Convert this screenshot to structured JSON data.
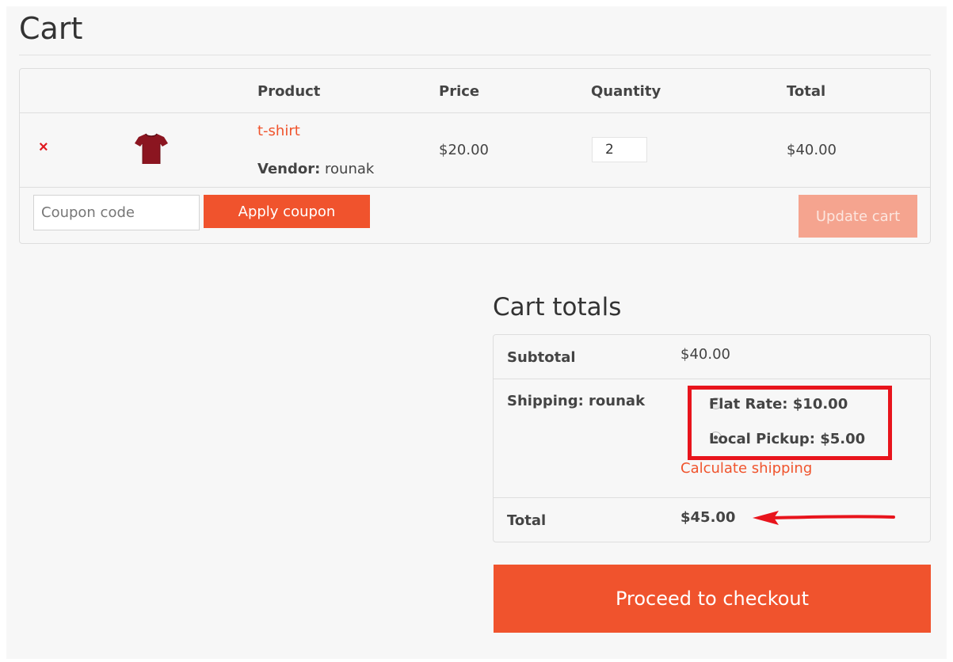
{
  "page": {
    "title": "Cart"
  },
  "cart_table": {
    "headers": {
      "product": "Product",
      "price": "Price",
      "quantity": "Quantity",
      "total": "Total"
    },
    "items": [
      {
        "remove_icon": "×",
        "thumbnail_icon": "tshirt-icon",
        "name": "t-shirt",
        "vendor_label": "Vendor:",
        "vendor_name": "rounak",
        "price": "$20.00",
        "quantity": "2",
        "total": "$40.00"
      }
    ],
    "coupon_placeholder": "Coupon code",
    "apply_coupon_label": "Apply coupon",
    "update_cart_label": "Update cart"
  },
  "cart_totals": {
    "title": "Cart totals",
    "subtotal_label": "Subtotal",
    "subtotal_value": "$40.00",
    "shipping_label": "Shipping: rounak",
    "shipping_options": [
      {
        "label": "Flat Rate: $10.00",
        "selected": false
      },
      {
        "label": "Local Pickup: $5.00",
        "selected": true
      }
    ],
    "calculate_shipping_label": "Calculate shipping",
    "total_label": "Total",
    "total_value": "$45.00",
    "checkout_label": "Proceed to checkout"
  },
  "colors": {
    "accent": "#f0532d",
    "accent_disabled": "#f5a48f",
    "annotation_red": "#e8141c",
    "remove_red": "#e0191f",
    "product_maroon": "#8b1520"
  }
}
